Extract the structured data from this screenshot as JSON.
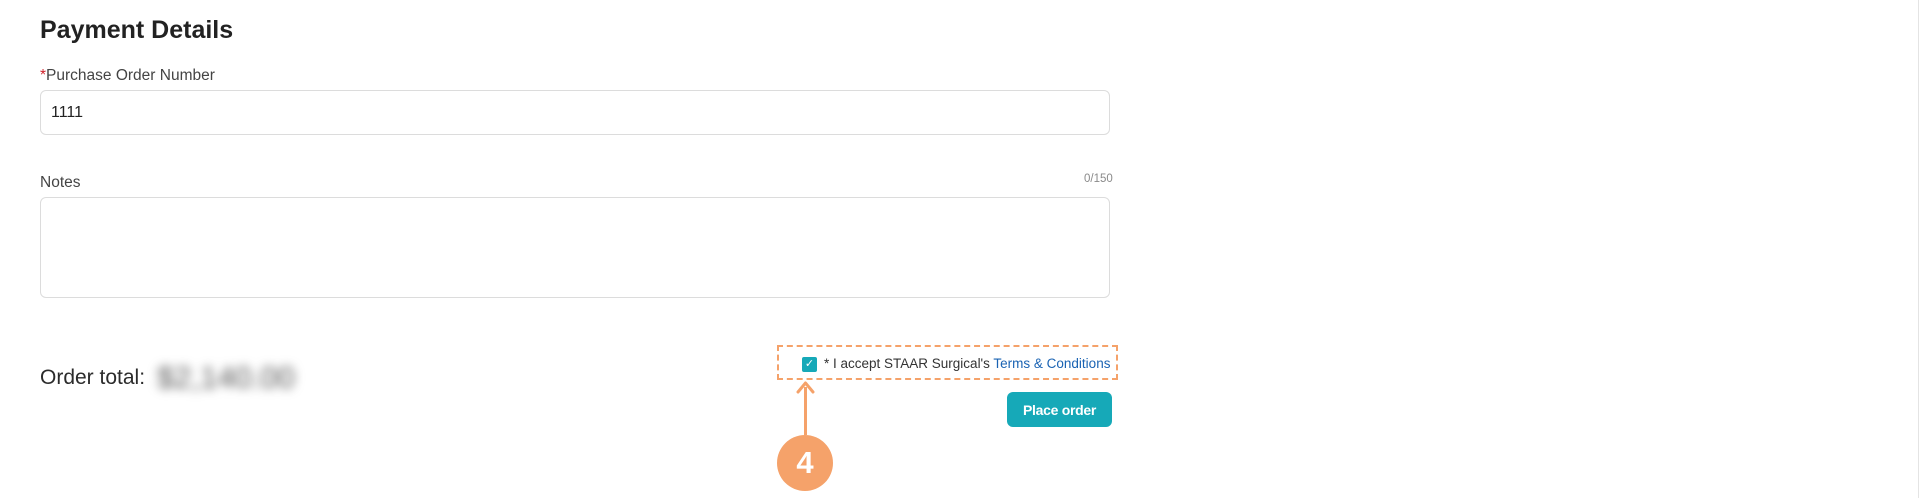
{
  "section": {
    "title": "Payment Details"
  },
  "po": {
    "required_mark": "*",
    "label": "Purchase Order Number",
    "value": "1111"
  },
  "notes": {
    "label": "Notes",
    "counter": "0/150"
  },
  "order": {
    "total_label": "Order total:",
    "total_amount": "$2,140.00",
    "total_amount_obscured": true
  },
  "terms": {
    "checked": true,
    "text": "* I accept STAAR Surgical's",
    "link": "Terms & Conditions"
  },
  "actions": {
    "place_order": "Place order"
  },
  "annotation": {
    "step_number": "4",
    "color": "#f5a26a"
  },
  "colors": {
    "accent": "#16a9b8",
    "link": "#1a63b3",
    "required": "#d0212a"
  }
}
